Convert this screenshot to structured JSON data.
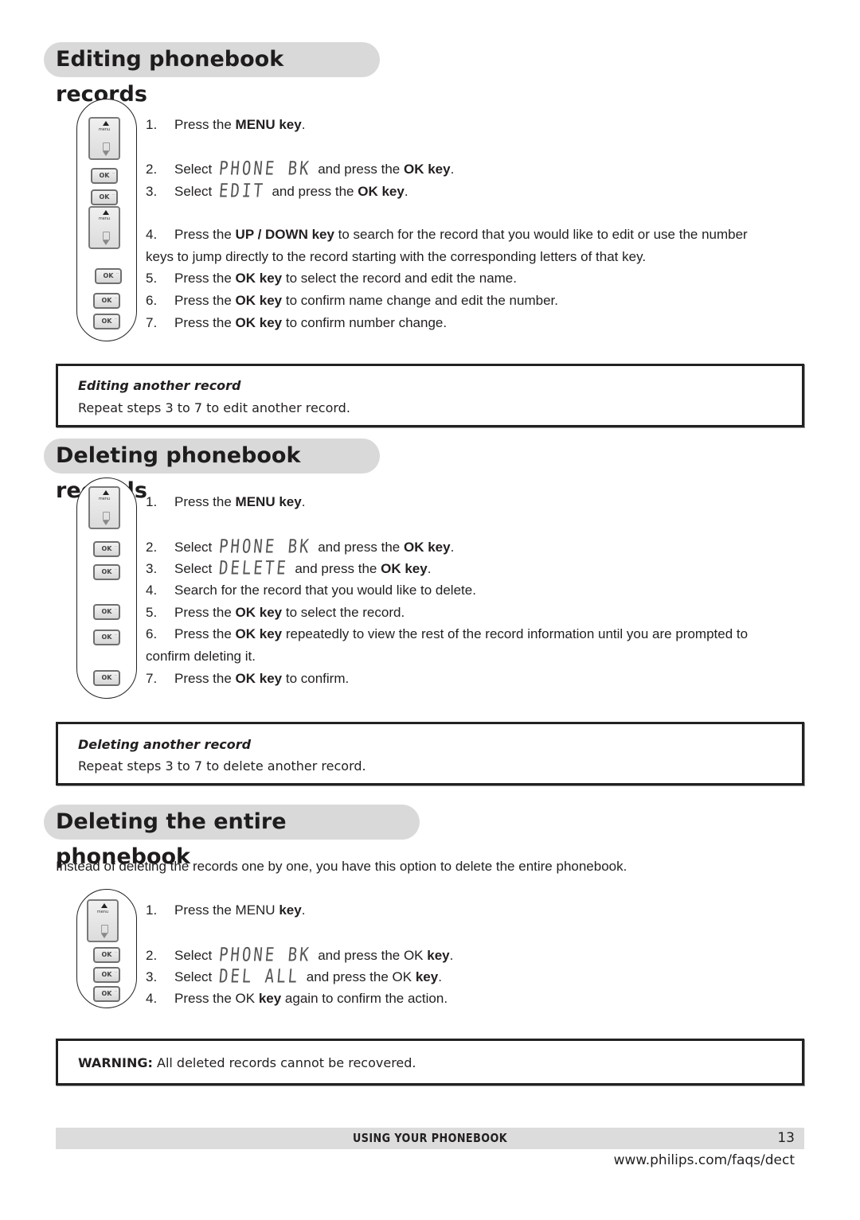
{
  "sections": [
    {
      "title": "Editing phonebook records",
      "steps": [
        {
          "num": "1.",
          "pre": "Press the ",
          "bold": "MENU key",
          "post": "."
        },
        {
          "num": "2.",
          "pre": "Select ",
          "lcd": "PHONE BK",
          "mid": " and press the ",
          "bold": "OK key",
          "post": "."
        },
        {
          "num": "3.",
          "pre": "Select ",
          "lcd": "EDIT",
          "mid": " and press the ",
          "bold": "OK key",
          "post": "."
        },
        {
          "num": "4.",
          "pre": "Press the ",
          "bold": "UP / DOWN key",
          "post": " to search for the record that you would like to edit or use the number",
          "cont": "keys to jump directly to the record starting with the corresponding letters of that key."
        },
        {
          "num": "5.",
          "pre": "Press the ",
          "bold": "OK key",
          "post": " to select the record and edit the name."
        },
        {
          "num": "6.",
          "pre": "Press the ",
          "bold": "OK key",
          "post": " to confirm name change and edit the number."
        },
        {
          "num": "7.",
          "pre": "Press the ",
          "bold": "OK key",
          "post": " to confirm number change."
        }
      ],
      "note": {
        "title": "Editing another record",
        "text": "Repeat steps 3 to 7 to edit another record."
      }
    },
    {
      "title": "Deleting phonebook records",
      "steps": [
        {
          "num": "1.",
          "pre": "Press the ",
          "bold": "MENU key",
          "post": "."
        },
        {
          "num": "2.",
          "pre": "Select ",
          "lcd": "PHONE BK",
          "mid": " and press the ",
          "bold": "OK key",
          "post": "."
        },
        {
          "num": "3.",
          "pre": "Select ",
          "lcd": "DELETE",
          "mid": " and press the ",
          "bold": "OK key",
          "post": "."
        },
        {
          "num": "4.",
          "pre": "Search for the record that you would like to delete.",
          "bold": "",
          "post": ""
        },
        {
          "num": "5.",
          "pre": "Press the ",
          "bold": "OK key",
          "post": " to select the record."
        },
        {
          "num": "6.",
          "pre": "Press the ",
          "bold": "OK key",
          "post": " repeatedly to view the rest of the record information until you are prompted to",
          "cont": "confirm deleting it."
        },
        {
          "num": "7.",
          "pre": "Press the ",
          "bold": "OK key",
          "post": " to confirm."
        }
      ],
      "note": {
        "title": "Deleting another record",
        "text": "Repeat steps 3 to 7 to delete another record."
      }
    },
    {
      "title": "Deleting the entire phonebook",
      "intro": "Instead of deleting the records one by one, you have this option to delete the entire phonebook.",
      "steps": [
        {
          "num": "1.",
          "pre": "Press the MENU ",
          "bold": "key",
          "post": "."
        },
        {
          "num": "2.",
          "pre": "Select ",
          "lcd": "PHONE BK",
          "mid": " and press the OK ",
          "bold": "key",
          "post": "."
        },
        {
          "num": "3.",
          "pre": "Select ",
          "lcd": "DEL ALL",
          "mid": " and press the OK ",
          "bold": "key",
          "post": "."
        },
        {
          "num": "4.",
          "pre": "Press the OK ",
          "bold": "key",
          "post": " again to confirm the action."
        }
      ],
      "warning": {
        "label": "WARNING:",
        "text": "All deleted records cannot be recovered."
      }
    }
  ],
  "keys": {
    "menu_label": "menu",
    "ok_label": "OK"
  },
  "footer": {
    "title": "USING YOUR PHONEBOOK",
    "page": "13",
    "url": "www.philips.com/faqs/dect"
  }
}
